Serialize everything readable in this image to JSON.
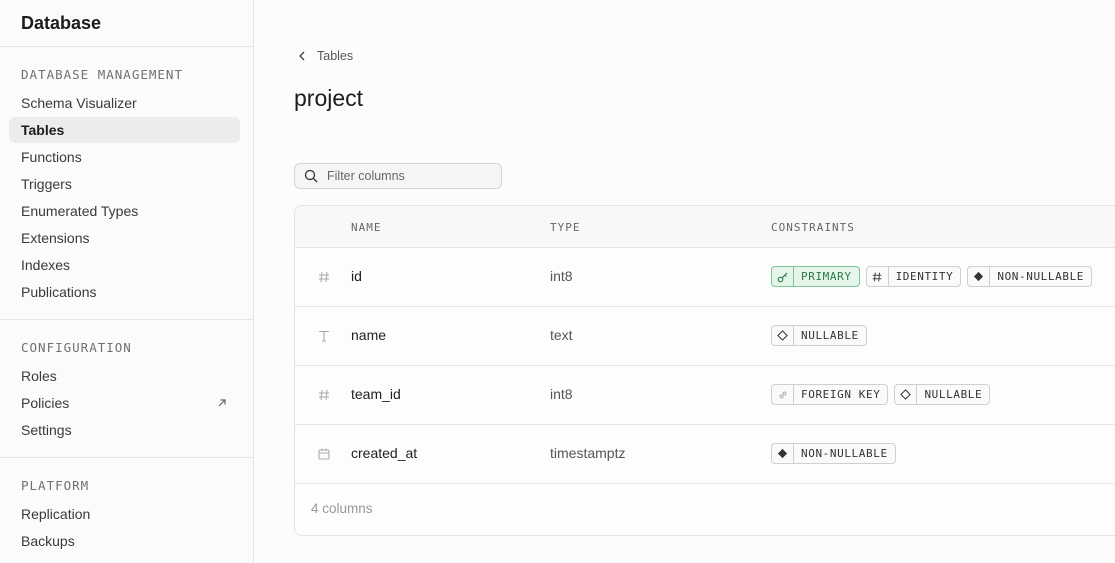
{
  "sidebar": {
    "title": "Database",
    "sections": [
      {
        "title": "DATABASE MANAGEMENT",
        "items": [
          "Schema Visualizer",
          "Tables",
          "Functions",
          "Triggers",
          "Enumerated Types",
          "Extensions",
          "Indexes",
          "Publications"
        ]
      },
      {
        "title": "CONFIGURATION",
        "items": [
          "Roles",
          "Policies",
          "Settings"
        ]
      },
      {
        "title": "PLATFORM",
        "items": [
          "Replication",
          "Backups"
        ]
      }
    ],
    "active_item": "Tables"
  },
  "breadcrumb": {
    "label": "Tables"
  },
  "page": {
    "title": "project"
  },
  "filter": {
    "placeholder": "Filter columns",
    "value": ""
  },
  "table": {
    "headers": {
      "name": "NAME",
      "type": "TYPE",
      "constraints": "CONSTRAINTS"
    },
    "rows": [
      {
        "icon": "hash-icon",
        "name": "id",
        "type": "int8",
        "constraints": [
          {
            "label": "PRIMARY",
            "icon": "key-icon",
            "style": "primary"
          },
          {
            "label": "IDENTITY",
            "icon": "hash-icon",
            "style": "default"
          },
          {
            "label": "NON-NULLABLE",
            "icon": "filled-diamond-icon",
            "style": "default"
          }
        ]
      },
      {
        "icon": "text-type-icon",
        "name": "name",
        "type": "text",
        "constraints": [
          {
            "label": "NULLABLE",
            "icon": "outline-diamond-icon",
            "style": "default"
          }
        ]
      },
      {
        "icon": "hash-icon",
        "name": "team_id",
        "type": "int8",
        "constraints": [
          {
            "label": "FOREIGN KEY",
            "icon": "link-icon",
            "style": "default"
          },
          {
            "label": "NULLABLE",
            "icon": "outline-diamond-icon",
            "style": "default"
          }
        ]
      },
      {
        "icon": "calendar-icon",
        "name": "created_at",
        "type": "timestamptz",
        "constraints": [
          {
            "label": "NON-NULLABLE",
            "icon": "filled-diamond-icon",
            "style": "default"
          }
        ]
      }
    ],
    "footer": "4 columns"
  },
  "colors": {
    "primary_bg": "#e5f5ea",
    "primary_border": "#7cc596",
    "primary_text": "#2c7a48"
  }
}
